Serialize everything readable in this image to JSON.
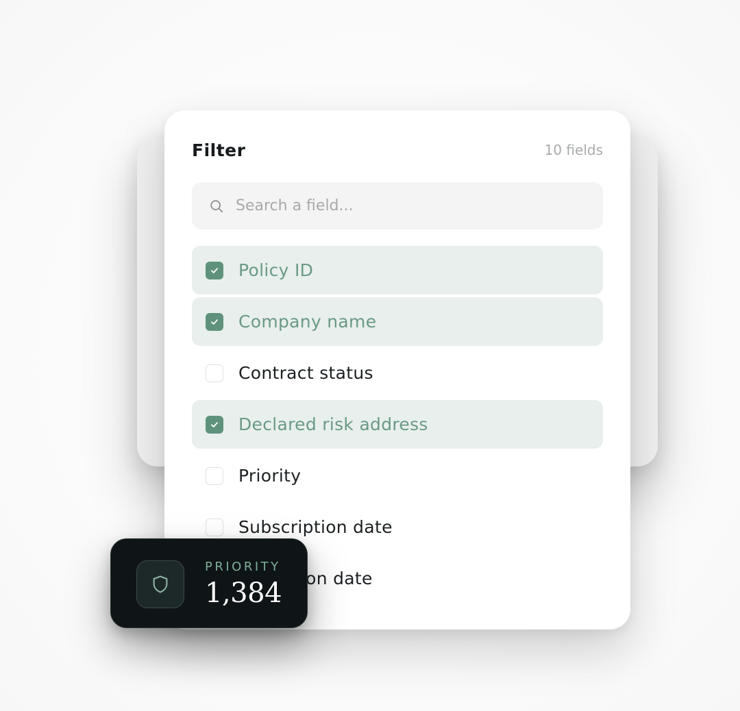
{
  "filter_panel": {
    "title": "Filter",
    "field_count": "10 fields",
    "search": {
      "placeholder": "Search a field...",
      "value": ""
    },
    "fields": [
      {
        "label": "Policy ID",
        "checked": true
      },
      {
        "label": "Company name",
        "checked": true
      },
      {
        "label": "Contract status",
        "checked": false
      },
      {
        "label": "Declared risk address",
        "checked": true
      },
      {
        "label": "Priority",
        "checked": false
      },
      {
        "label": "Subscription date",
        "checked": false
      },
      {
        "label": "Expiration date",
        "checked": false
      }
    ]
  },
  "stat_card": {
    "label": "PRIORITY",
    "value": "1,384",
    "icon": "shield-icon"
  },
  "colors": {
    "accent": "#5f927c",
    "checked_row_bg": "#e8efec",
    "checked_text": "#6a9a85",
    "card_bg": "#0f1517",
    "card_label": "#7fae99"
  }
}
